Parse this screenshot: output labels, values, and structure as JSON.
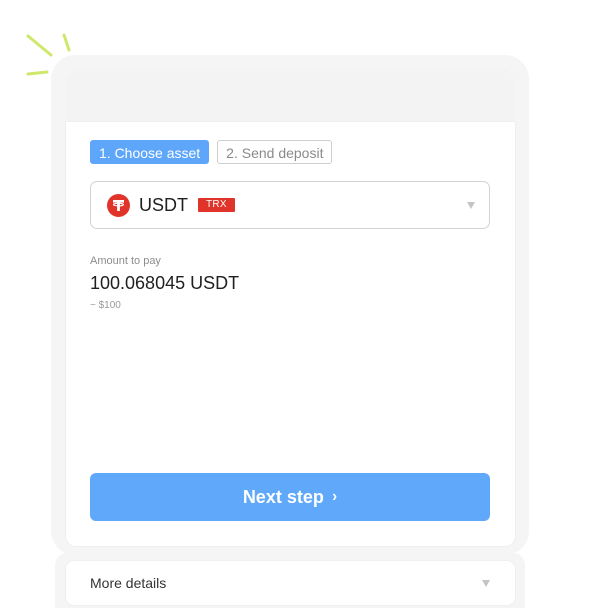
{
  "steps": [
    {
      "label": "1. Choose asset",
      "active": true
    },
    {
      "label": "2. Send deposit",
      "active": false
    }
  ],
  "asset": {
    "icon": "tether-icon",
    "name": "USDT",
    "network": "TRX"
  },
  "amount": {
    "label": "Amount to pay",
    "value": "100.068045 USDT",
    "usd": "~ $100"
  },
  "next_button": {
    "label": "Next step",
    "chevron": "›"
  },
  "details": {
    "label": "More details"
  },
  "colors": {
    "accent": "#5ea6f9",
    "tether": "#e0342b",
    "sparkle": "#cde86a"
  }
}
